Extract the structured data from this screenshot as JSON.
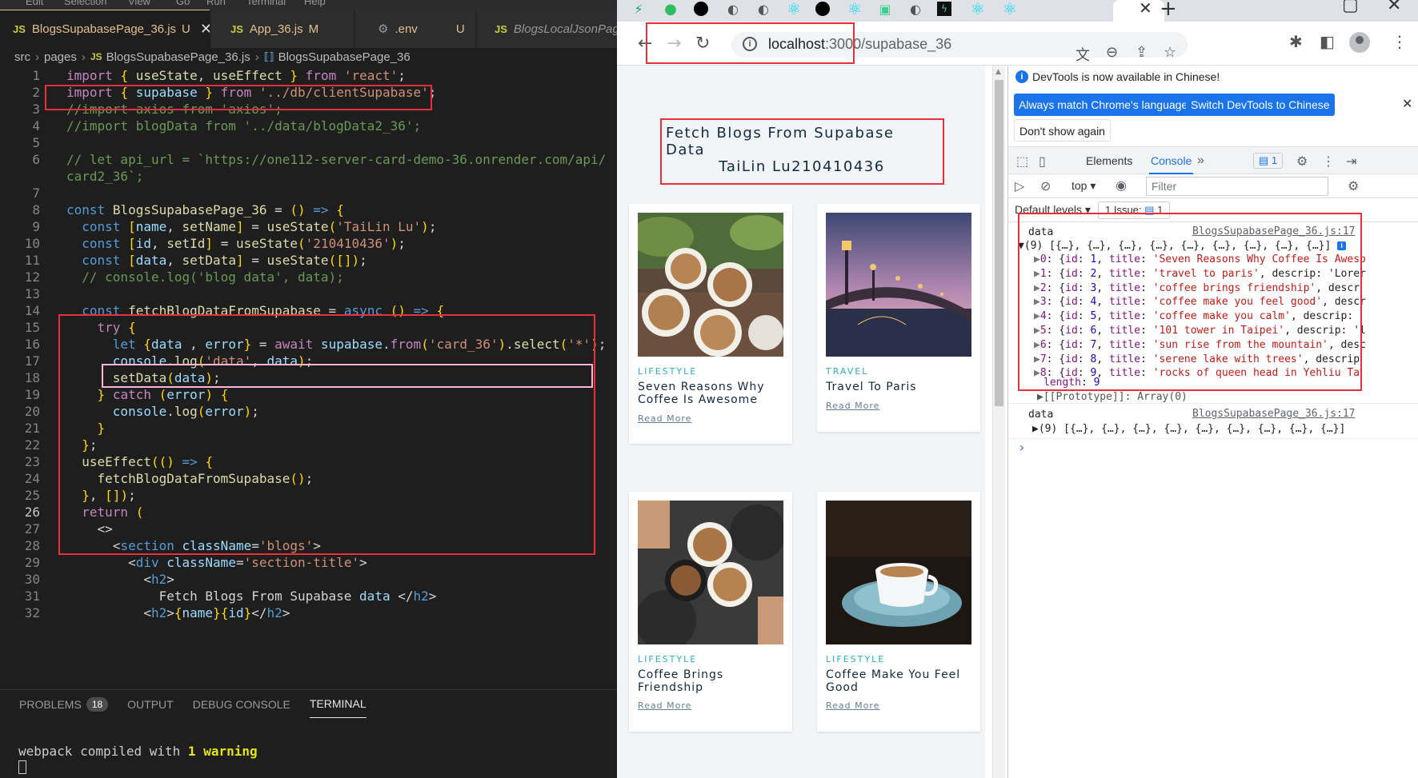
{
  "menu": {
    "items": [
      "Edit",
      "Selection",
      "View",
      "Go",
      "Run",
      "Terminal",
      "Help"
    ]
  },
  "editor": {
    "tabs": [
      {
        "icon": "JS",
        "label": "BlogsSupabasePage_36.js",
        "status": "U"
      },
      {
        "icon": "JS",
        "label": "App_36.js",
        "status": "M"
      },
      {
        "icon": "gear",
        "label": ".env",
        "status": "U"
      },
      {
        "icon": "JS",
        "label": "BlogsLocalJsonPage_"
      }
    ],
    "breadcrumb": [
      "src",
      "pages",
      "BlogsSupabasePage_36.js",
      "BlogsSupabasePage_36"
    ],
    "lines": [
      "import { useState, useEffect } from 'react';",
      "import { supabase } from '../db/clientSupabase';",
      "//import axios from 'axios';",
      "//import blogData from '../data/blogData2_36';",
      "",
      "// let api_url = `https://one112-server-card-demo-36.onrender.com/api/",
      "card2_36`;",
      "",
      "const BlogsSupabasePage_36 = () => {",
      "  const [name, setName] = useState('TaiLin Lu');",
      "  const [id, setId] = useState('210410436');",
      "  const [data, setData] = useState([]);",
      "  // console.log('blog data', data);",
      "",
      "  const fetchBlogDataFromSupabase = async () => {",
      "    try {",
      "      let {data , error} = await supabase.from('card_36').select('*');",
      "      console.log('data', data);",
      "      setData(data);",
      "    } catch (error) {",
      "      console.log(error);",
      "    }",
      "  };",
      "  useEffect(() => {",
      "    fetchBlogDataFromSupabase();",
      "  }, []);",
      "  return (",
      "    <>",
      "      <section className='blogs'>",
      "        <div className='section-title'>",
      "          <h2>",
      "            Fetch Blogs From Supabase data </h2>",
      "          <h2>{name}{id}</h2>"
    ],
    "line_numbers": [
      "1",
      "2",
      "3",
      "4",
      "5",
      "6",
      "",
      "7",
      "8",
      "9",
      "10",
      "11",
      "12",
      "13",
      "14",
      "15",
      "16",
      "17",
      "18",
      "19",
      "20",
      "21",
      "22",
      "23",
      "24",
      "25",
      "26",
      "27",
      "28",
      "29",
      "30",
      "31",
      "32"
    ]
  },
  "panel": {
    "tabs": [
      {
        "label": "PROBLEMS",
        "badge": "18"
      },
      {
        "label": "OUTPUT"
      },
      {
        "label": "DEBUG CONSOLE"
      },
      {
        "label": "TERMINAL"
      }
    ],
    "terminal": {
      "prefix": "webpack compiled with ",
      "warning": "1 warning"
    }
  },
  "browser": {
    "url_host": "localhost",
    "url_path": ":3000/supabase_36",
    "page": {
      "title_line1": "Fetch Blogs From Supabase Data",
      "title_line2": "TaiLin Lu210410436",
      "read_more": "Read More",
      "cards": [
        {
          "category": "LIFESTYLE",
          "title": "Seven Reasons Why Coffee Is Awesome"
        },
        {
          "category": "TRAVEL",
          "title": "Travel To Paris"
        },
        {
          "category": "LIFESTYLE",
          "title": "Coffee Brings Friendship"
        },
        {
          "category": "LIFESTYLE",
          "title": "Coffee Make You Feel Good"
        }
      ]
    }
  },
  "devtools": {
    "notice": "DevTools is now available in Chinese!",
    "btn_match": "Always match Chrome's language",
    "btn_switch": "Switch DevTools to Chinese",
    "btn_dont": "Don't show again",
    "tab_elements": "Elements",
    "tab_console": "Console",
    "issue_count": "1",
    "context": "top",
    "filter_placeholder": "Filter",
    "levels": "Default levels",
    "issues_label": "1 Issue:",
    "issues_count": "1",
    "log_label": "data",
    "log_source": "BlogsSupabasePage_36.js:17",
    "array_summary": "(9) [{…}, {…}, {…}, {…}, {…}, {…}, {…}, {…}, {…}]",
    "rows": [
      {
        "idx": "0",
        "id": "1",
        "title": "'Seven Reasons Why Coffee Is Aweso",
        "tail": ""
      },
      {
        "idx": "1",
        "id": "2",
        "title": "'travel to paris'",
        "tail": ", descrip: 'Lorer"
      },
      {
        "idx": "2",
        "id": "3",
        "title": "'coffee brings friendship'",
        "tail": ", descr"
      },
      {
        "idx": "3",
        "id": "4",
        "title": "'coffee make you feel good'",
        "tail": ", descr"
      },
      {
        "idx": "4",
        "id": "5",
        "title": "'coffee make you calm'",
        "tail": ", descrip:"
      },
      {
        "idx": "5",
        "id": "6",
        "title": "'101 tower in Taipei'",
        "tail": ", descrip: 'l"
      },
      {
        "idx": "6",
        "id": "7",
        "title": "'sun rise from the mountain'",
        "tail": ", desc"
      },
      {
        "idx": "7",
        "id": "8",
        "title": "'serene lake with trees'",
        "tail": ", descrip"
      },
      {
        "idx": "8",
        "id": "9",
        "title": "'rocks of queen head in Yehliu Ta",
        "tail": ""
      }
    ],
    "length_label": "length",
    "length_value": "9",
    "prototype": "[[Prototype]]: Array(0)"
  }
}
